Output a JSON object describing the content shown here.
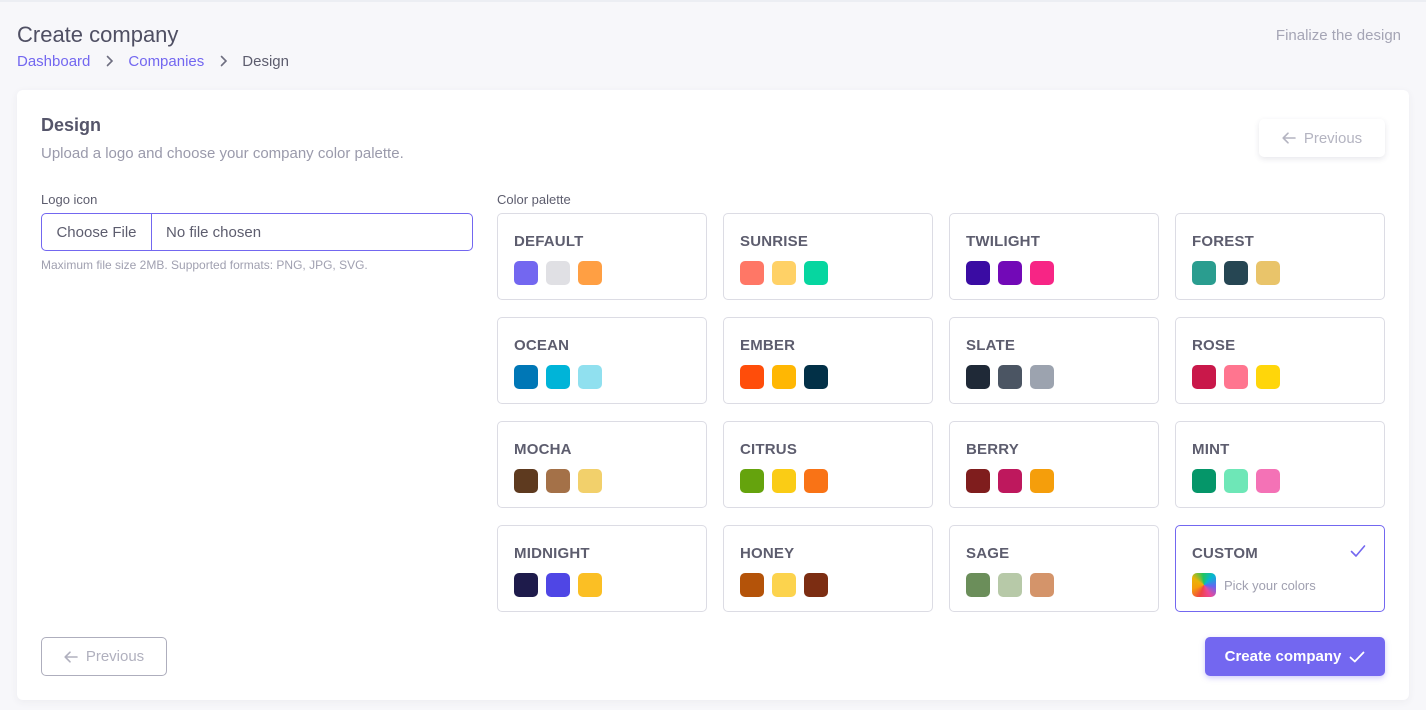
{
  "header": {
    "title": "Create company",
    "action_hint": "Finalize the design",
    "breadcrumb": [
      {
        "label": "Dashboard"
      },
      {
        "label": "Companies"
      },
      {
        "label": "Design"
      }
    ]
  },
  "card": {
    "title": "Design",
    "subtitle": "Upload a logo and choose your company color palette.",
    "previous_top_label": "Previous"
  },
  "logo": {
    "label": "Logo icon",
    "button_label": "Choose File",
    "value": "No file chosen",
    "help": "Maximum file size 2MB. Supported formats: PNG, JPG, SVG."
  },
  "palette": {
    "label": "Color palette",
    "selected": "CUSTOM",
    "options": [
      {
        "name": "DEFAULT",
        "colors": [
          "#7367f0",
          "#e0e0e4",
          "#ff9f43"
        ]
      },
      {
        "name": "SUNRISE",
        "colors": [
          "#ff7766",
          "#ffd166",
          "#06d6a0"
        ]
      },
      {
        "name": "TWILIGHT",
        "colors": [
          "#3a0ca3",
          "#7209b7",
          "#f72585"
        ]
      },
      {
        "name": "FOREST",
        "colors": [
          "#2a9d8f",
          "#264653",
          "#e9c46a"
        ]
      },
      {
        "name": "OCEAN",
        "colors": [
          "#0077b6",
          "#00b4d8",
          "#90e0ef"
        ]
      },
      {
        "name": "EMBER",
        "colors": [
          "#ff4d0a",
          "#ffb703",
          "#023047"
        ]
      },
      {
        "name": "SLATE",
        "colors": [
          "#1f2937",
          "#4b5563",
          "#9ca3af"
        ]
      },
      {
        "name": "ROSE",
        "colors": [
          "#c9184a",
          "#ff758f",
          "#ffd60a"
        ]
      },
      {
        "name": "MOCHA",
        "colors": [
          "#5e3a1f",
          "#a47148",
          "#f2d06b"
        ]
      },
      {
        "name": "CITRUS",
        "colors": [
          "#65a30d",
          "#facc15",
          "#f97316"
        ]
      },
      {
        "name": "BERRY",
        "colors": [
          "#7f1d1d",
          "#be185d",
          "#f59e0b"
        ]
      },
      {
        "name": "MINT",
        "colors": [
          "#059669",
          "#6ee7b7",
          "#f472b6"
        ]
      },
      {
        "name": "MIDNIGHT",
        "colors": [
          "#1e1b4b",
          "#4f46e5",
          "#fbbf24"
        ]
      },
      {
        "name": "HONEY",
        "colors": [
          "#b45309",
          "#fcd34d",
          "#7c2d12"
        ]
      },
      {
        "name": "SAGE",
        "colors": [
          "#6b8e5a",
          "#b7c9a8",
          "#d4946a"
        ]
      }
    ],
    "custom": {
      "name": "CUSTOM",
      "hint": "Pick your colors"
    }
  },
  "footer": {
    "previous_label": "Previous",
    "create_label": "Create company"
  },
  "colors": {
    "accent": "#7367f0"
  }
}
